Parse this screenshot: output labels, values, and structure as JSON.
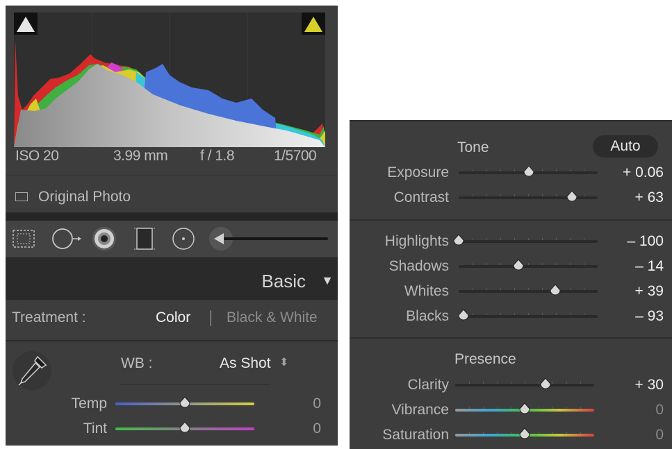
{
  "histogram": {
    "exif": {
      "iso": "ISO 20",
      "focal": "3.99 mm",
      "aperture": "f / 1.8",
      "shutter": "1/5700"
    },
    "original_photo_label": "Original Photo",
    "shadow_clip_color": "#e6e6e6",
    "highlight_clip_color": "#d6d12a"
  },
  "tools": [
    "crop-overlay-icon",
    "spot-removal-icon",
    "red-eye-icon",
    "graduated-filter-icon",
    "radial-filter-icon",
    "adjustment-brush-icon"
  ],
  "basic": {
    "title": "Basic",
    "collapse_arrow": "▼",
    "treatment": {
      "label": "Treatment :",
      "color": "Color",
      "separator": "|",
      "bw": "Black & White"
    },
    "wb": {
      "label": "WB :",
      "value": "As Shot",
      "stepper": "⬍"
    },
    "sliders": [
      {
        "key": "temp",
        "label": "Temp",
        "value": "0",
        "position": 0.5
      },
      {
        "key": "tint",
        "label": "Tint",
        "value": "0",
        "position": 0.5
      }
    ]
  },
  "tone": {
    "title": "Tone",
    "auto_label": "Auto",
    "sliders": [
      {
        "key": "exposure",
        "label": "Exposure",
        "value": "+ 0.06",
        "position": 0.505
      },
      {
        "key": "contrast",
        "label": "Contrast",
        "value": "+ 63",
        "position": 0.815
      },
      {
        "key": "highlights",
        "label": "Highlights",
        "value": "– 100",
        "position": 0.0
      },
      {
        "key": "shadows",
        "label": "Shadows",
        "value": "– 14",
        "position": 0.43
      },
      {
        "key": "whites",
        "label": "Whites",
        "value": "+ 39",
        "position": 0.695
      },
      {
        "key": "blacks",
        "label": "Blacks",
        "value": "– 93",
        "position": 0.035
      }
    ]
  },
  "presence": {
    "title": "Presence",
    "sliders": [
      {
        "key": "clarity",
        "label": "Clarity",
        "value": "+ 30",
        "position": 0.65
      },
      {
        "key": "vibrance",
        "label": "Vibrance",
        "value": "0",
        "position": 0.5
      },
      {
        "key": "saturation",
        "label": "Saturation",
        "value": "0",
        "position": 0.5
      }
    ]
  },
  "colors": {
    "panel": "#3d3d3d",
    "active_value": "#f0f0f0",
    "zero_value": "#8a8a8a",
    "temp_gradient": [
      "#4a5fd0",
      "#d4cf3c"
    ],
    "tint_gradient": [
      "#3fc246",
      "#c63fc8"
    ],
    "vibrance_gradient": [
      "#9a9a9a",
      "#3ea6d8",
      "#3fc246",
      "#c8c83c",
      "#d84040"
    ]
  }
}
